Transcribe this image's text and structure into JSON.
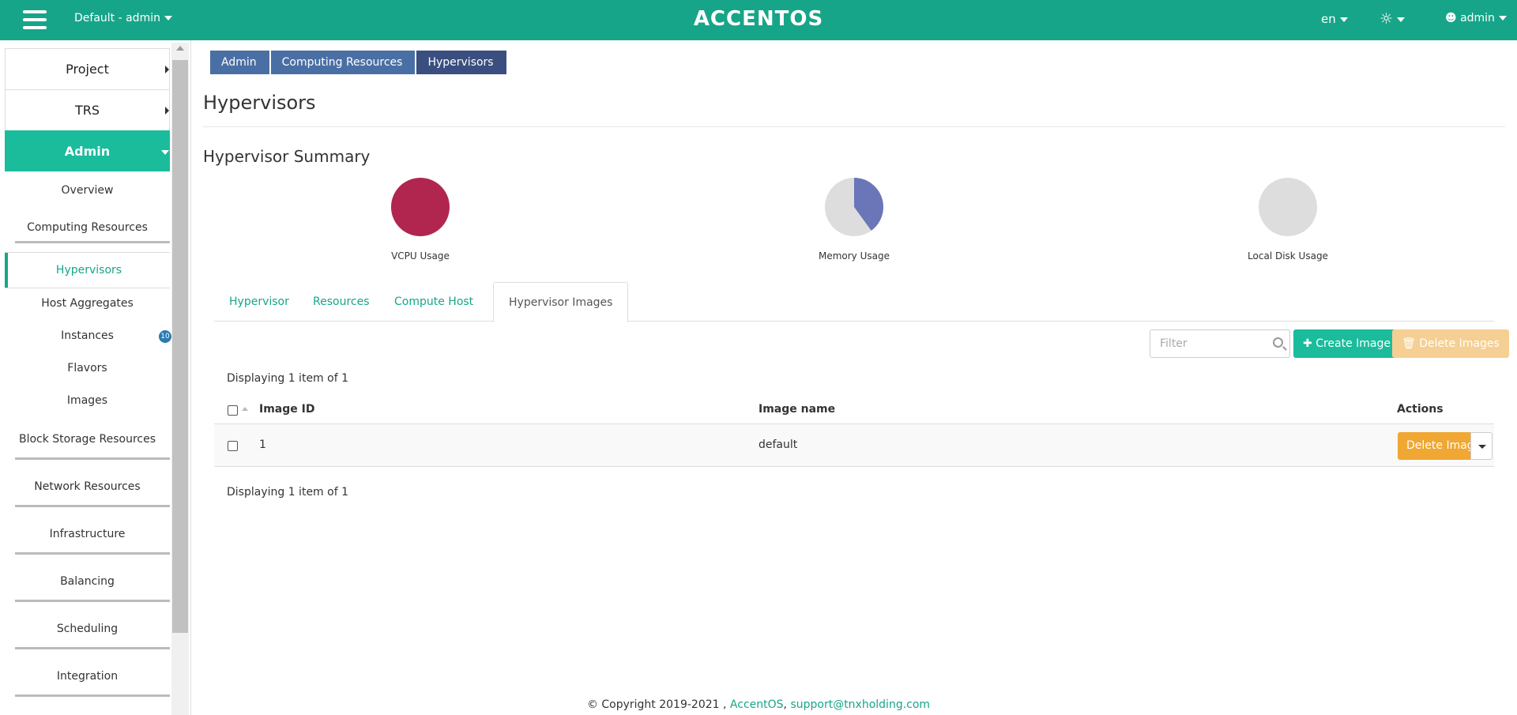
{
  "header": {
    "project_label": "Default - admin",
    "logo_text": "ACCENTOS",
    "language": "en",
    "user": "admin",
    "brand_color": "#17a589"
  },
  "sidebar": {
    "sections": [
      "Project",
      "TRS",
      "Admin"
    ],
    "items": [
      "Overview",
      "Computing Resources",
      "Hypervisors",
      "Host Aggregates",
      "Instances",
      "Flavors",
      "Images",
      "Block Storage Resources",
      "Network Resources",
      "Infrastructure",
      "Balancing",
      "Scheduling",
      "Integration"
    ],
    "instances_badge": "10"
  },
  "breadcrumb": [
    "Admin",
    "Computing Resources",
    "Hypervisors"
  ],
  "page": {
    "title": "Hypervisors",
    "summary_title": "Hypervisor Summary"
  },
  "charts": {
    "vcpu": {
      "label": "VCPU Usage",
      "used_fraction": 1.0,
      "color": "#b0264f"
    },
    "memory": {
      "label": "Memory Usage",
      "used_fraction": 0.4,
      "color": "#6a76b8"
    },
    "disk": {
      "label": "Local Disk Usage",
      "used_fraction": 0.0,
      "color": "#dddddd"
    }
  },
  "tabs": [
    "Hypervisor",
    "Resources",
    "Compute Host",
    "Hypervisor Images"
  ],
  "toolbar": {
    "filter_placeholder": "Filter",
    "create_label": "Create Image",
    "delete_all_label": "Delete Images"
  },
  "table": {
    "display_count": "Displaying 1 item of 1",
    "columns": [
      "Image ID",
      "Image name",
      "Actions"
    ],
    "rows": [
      {
        "id": "1",
        "name": "default",
        "action": "Delete Image"
      }
    ]
  },
  "footer": {
    "copyright": "© Copyright 2019-2021 ,",
    "link1": "AccentOS",
    "sep": ",",
    "link2": "support@tnxholding.com"
  }
}
